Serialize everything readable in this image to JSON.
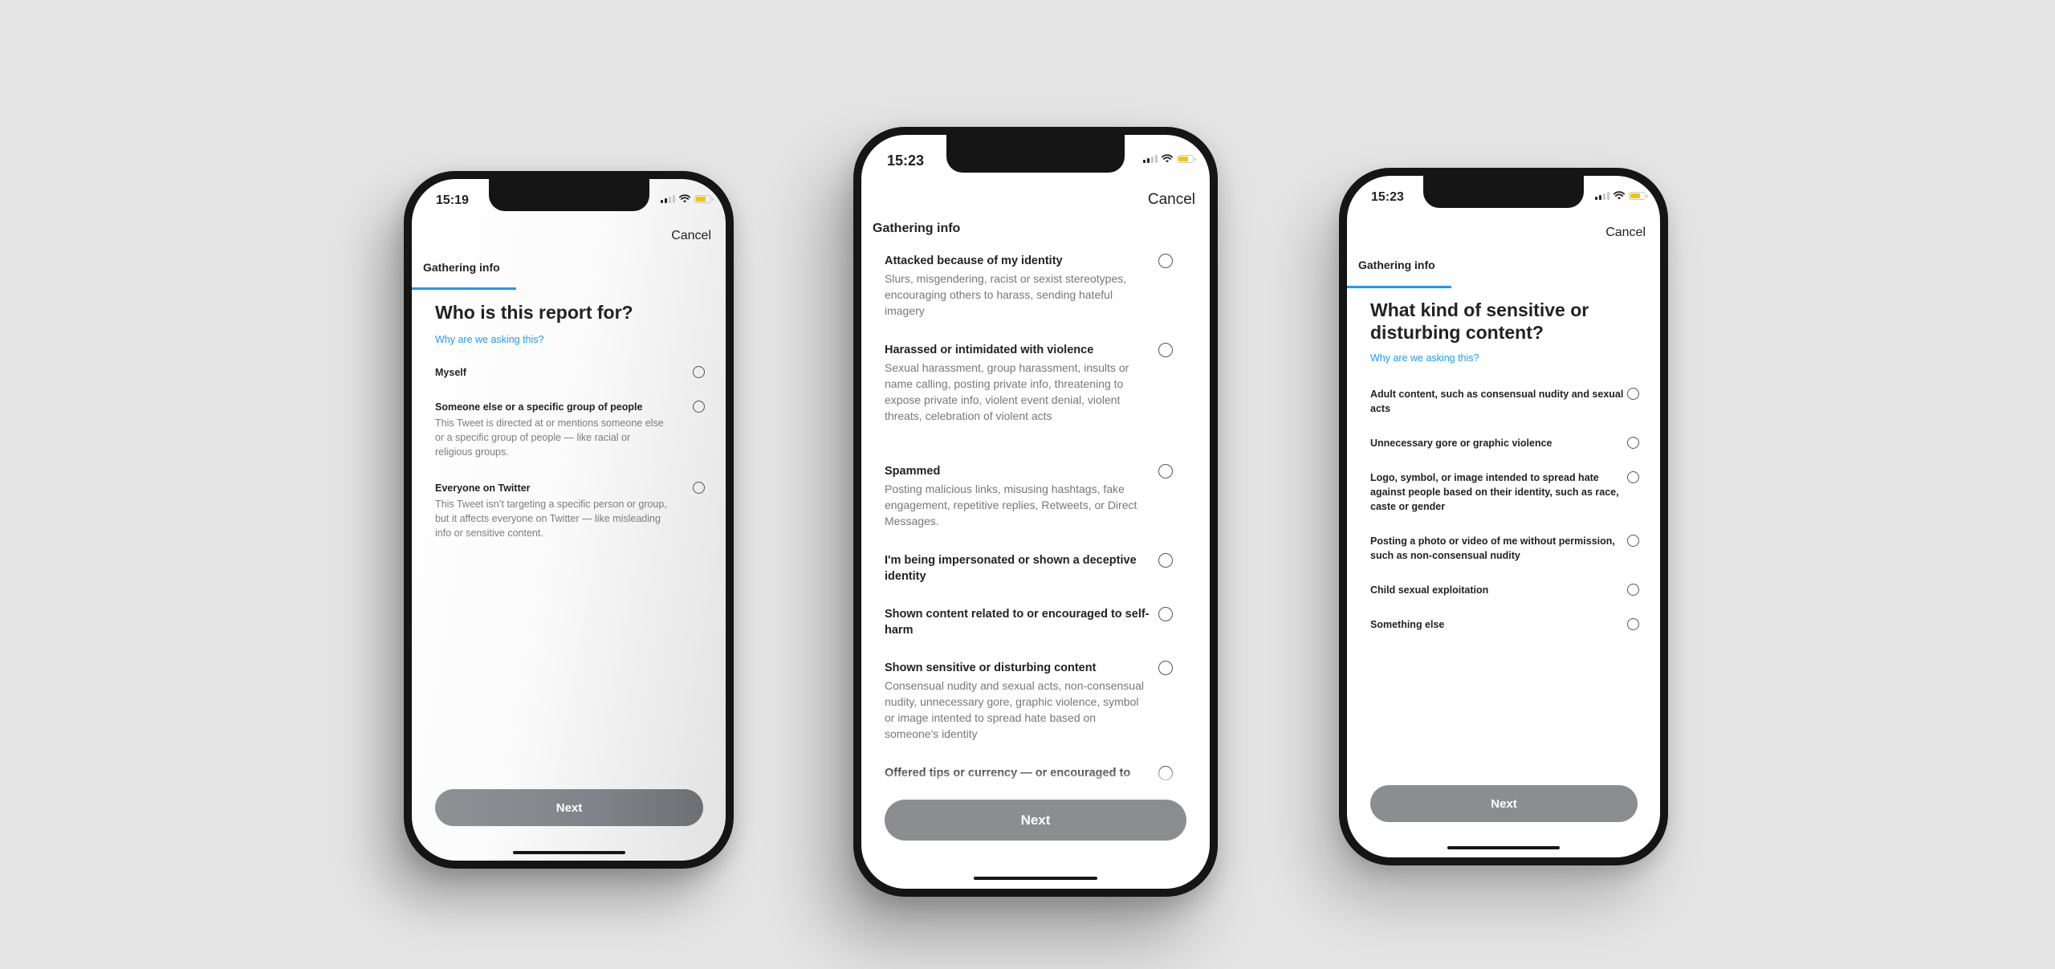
{
  "colors": {
    "background": "#e4e4e4",
    "accent": "#1d9bf0",
    "button_disabled": "#8b8e91",
    "battery": "#f5c400"
  },
  "phones": [
    {
      "status_time": "15:19",
      "cancel_label": "Cancel",
      "tab_label": "Gathering info",
      "title": "Who is this report for?",
      "why_link": "Why are we asking this?",
      "options": [
        {
          "label": "Myself",
          "desc": ""
        },
        {
          "label": "Someone else or a specific group of people",
          "desc": "This Tweet is directed at or mentions someone else or a specific group of people — like racial or religious groups."
        },
        {
          "label": "Everyone on Twitter",
          "desc": "This Tweet isn’t targeting a specific person or group, but it affects everyone on Twitter — like misleading info or sensitive content."
        }
      ],
      "next_label": "Next"
    },
    {
      "status_time": "15:23",
      "cancel_label": "Cancel",
      "tab_label": "Gathering info",
      "options": [
        {
          "label": "Attacked because of my identity",
          "desc": "Slurs, misgendering, racist or sexist stereotypes, encouraging others to harass, sending hateful imagery"
        },
        {
          "label": "Harassed or intimidated with violence",
          "desc": "Sexual harassment, group harassment, insults or name calling, posting private info, threatening to expose private info, violent event denial, violent threats, celebration of violent acts"
        },
        {
          "label": "Spammed",
          "desc": "Posting malicious links, misusing hashtags, fake engagement, repetitive replies, Retweets, or Direct Messages."
        },
        {
          "label": "I'm being impersonated or shown a deceptive identity",
          "desc": ""
        },
        {
          "label": "Shown content related to or encouraged to self-harm",
          "desc": ""
        },
        {
          "label": "Shown sensitive or disturbing content",
          "desc": "Consensual nudity and sexual acts, non-consensual nudity, unnecessary gore, graphic violence, symbol or image intented to spread hate based on someone's identity"
        },
        {
          "label": "Offered tips or currency — or encouraged to",
          "desc": ""
        }
      ],
      "next_label": "Next"
    },
    {
      "status_time": "15:23",
      "cancel_label": "Cancel",
      "tab_label": "Gathering info",
      "title": "What kind of sensitive or disturbing content?",
      "why_link": "Why are we asking this?",
      "options": [
        {
          "label": "Adult content, such as consensual nudity and sexual acts",
          "desc": ""
        },
        {
          "label": "Unnecessary gore or graphic violence",
          "desc": ""
        },
        {
          "label": "Logo, symbol, or image intended to spread hate against people based on their identity, such as race, caste or gender",
          "desc": ""
        },
        {
          "label": "Posting a photo or video of me without permission, such as non-consensual nudity",
          "desc": ""
        },
        {
          "label": "Child sexual exploitation",
          "desc": ""
        },
        {
          "label": "Something else",
          "desc": ""
        }
      ],
      "next_label": "Next"
    }
  ]
}
